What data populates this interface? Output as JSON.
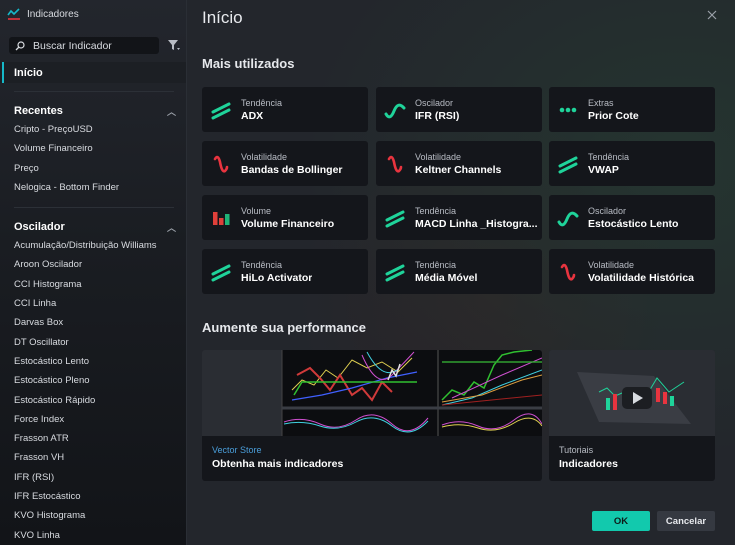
{
  "sidebar": {
    "title": "Indicadores",
    "search": {
      "placeholder": "Buscar Indicador",
      "value": ""
    },
    "home_label": "Início",
    "sections": [
      {
        "label": "Recentes",
        "items": [
          "Cripto - PreçoUSD",
          "Volume Financeiro",
          "Preço",
          "Nelogica - Bottom Finder"
        ]
      },
      {
        "label": "Oscilador",
        "items": [
          "Acumulação/Distribuição Williams",
          "Aroon Oscilador",
          "CCI Histograma",
          "CCI Linha",
          "Darvas Box",
          "DT Oscillator",
          "Estocástico Lento",
          "Estocástico Pleno",
          "Estocástico Rápido",
          "Force Index",
          "Frasson ATR",
          "Frasson VH",
          "IFR (RSI)",
          "IFR Estocástico",
          "KVO Histograma",
          "KVO Linha"
        ]
      }
    ]
  },
  "main": {
    "title": "Início",
    "most_used_title": "Mais utilizados",
    "cards": [
      {
        "category": "Tendência",
        "name": "ADX",
        "icon": "trend-icon"
      },
      {
        "category": "Oscilador",
        "name": "IFR (RSI)",
        "icon": "oscillator-icon"
      },
      {
        "category": "Extras",
        "name": "Prior Cote",
        "icon": "extras-dots-icon"
      },
      {
        "category": "Volatilidade",
        "name": "Bandas de Bollinger",
        "icon": "volatility-icon"
      },
      {
        "category": "Volatilidade",
        "name": "Keltner Channels",
        "icon": "volatility-icon"
      },
      {
        "category": "Tendência",
        "name": "VWAP",
        "icon": "trend-icon"
      },
      {
        "category": "Volume",
        "name": "Volume Financeiro",
        "icon": "volume-bars-icon"
      },
      {
        "category": "Tendência",
        "name": "MACD Linha _Histogra...",
        "icon": "trend-icon"
      },
      {
        "category": "Oscilador",
        "name": "Estocástico Lento",
        "icon": "oscillator-icon"
      },
      {
        "category": "Tendência",
        "name": "HiLo Activator",
        "icon": "trend-icon"
      },
      {
        "category": "Tendência",
        "name": "Média Móvel",
        "icon": "trend-icon"
      },
      {
        "category": "Volatilidade",
        "name": "Volatilidade Histórica",
        "icon": "volatility-icon"
      }
    ],
    "performance_title": "Aumente sua performance",
    "promos": [
      {
        "kicker": "Vector Store",
        "title": "Obtenha mais indicadores"
      },
      {
        "kicker": "Tutoriais",
        "title": "Indicadores"
      }
    ],
    "ok_label": "OK",
    "cancel_label": "Cancelar"
  },
  "colors": {
    "accent": "#12c9ad",
    "trend_green": "#1fd39a",
    "volatility_red": "#e8343f",
    "link_blue": "#4a9eda",
    "selected_bar": "#16b8c8"
  }
}
